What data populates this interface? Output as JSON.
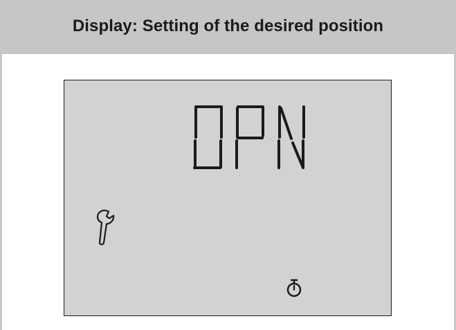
{
  "header": {
    "title": "Display: Setting of the desired position"
  },
  "lcd": {
    "text": "OPN"
  },
  "icons": {
    "wrench": "wrench-icon",
    "timer": "stopwatch-icon"
  },
  "colors": {
    "header_background": "#c6c6c6",
    "lcd_background": "#d2d2d2",
    "segment_color": "#1a1a1a"
  }
}
